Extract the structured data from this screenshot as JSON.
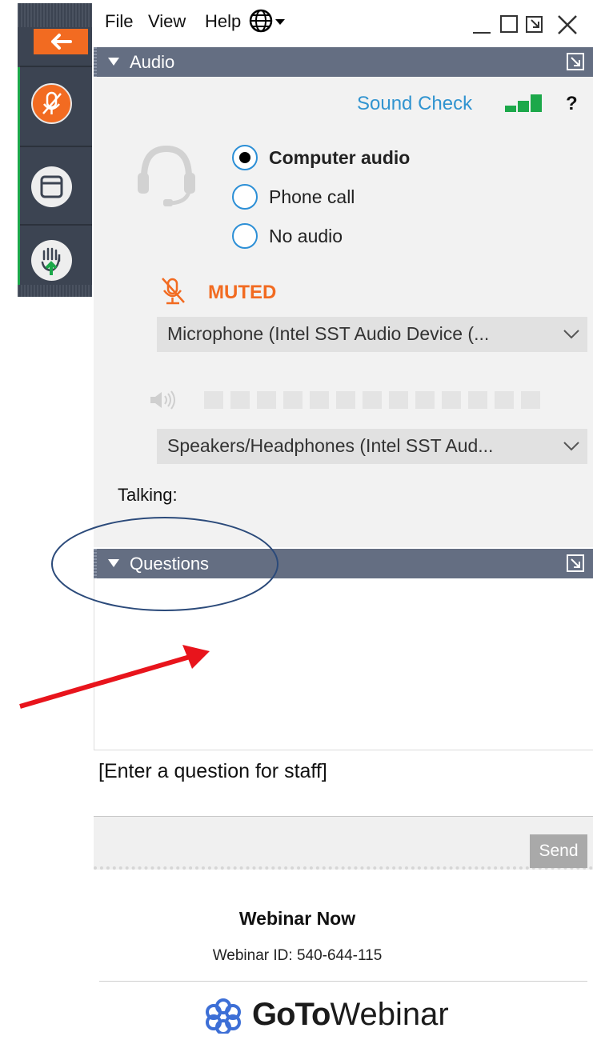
{
  "menu": {
    "file": "File",
    "view": "View",
    "help": "Help",
    "language_icon": "globe-icon",
    "window_controls": [
      "minimize-icon",
      "maximize-icon",
      "restore-icon",
      "close-icon"
    ]
  },
  "toolbar": {
    "buttons": [
      "back-arrow-icon",
      "microphone-muted-icon",
      "screen-window-icon",
      "raise-hand-icon"
    ],
    "accent_color": "#f26b21"
  },
  "audio": {
    "header": "Audio",
    "sound_check": "Sound Check",
    "help_mark": "?",
    "options": [
      {
        "label": "Computer audio",
        "selected": true
      },
      {
        "label": "Phone call",
        "selected": false
      },
      {
        "label": "No audio",
        "selected": false
      }
    ],
    "mute_status": "MUTED",
    "microphone": "Microphone (Intel SST Audio Device (...",
    "speakers": "Speakers/Headphones (Intel SST Aud...",
    "volume_level": 0,
    "talking_label": "Talking:"
  },
  "questions": {
    "header": "Questions",
    "input_placeholder": "[Enter a question for staff]",
    "send_label": "Send"
  },
  "footer": {
    "webinar_title": "Webinar Now",
    "webinar_id": "Webinar ID: 540-644-115",
    "brand_goto": "GoTo",
    "brand_webinar": "Webinar"
  },
  "colors": {
    "header_bg": "#646e82",
    "link_blue": "#3194d0",
    "muted_orange": "#f26b21",
    "signal_green": "#1ca84a",
    "annotation_red": "#e8141c",
    "annotation_ellipse": "#2b4a7a"
  }
}
